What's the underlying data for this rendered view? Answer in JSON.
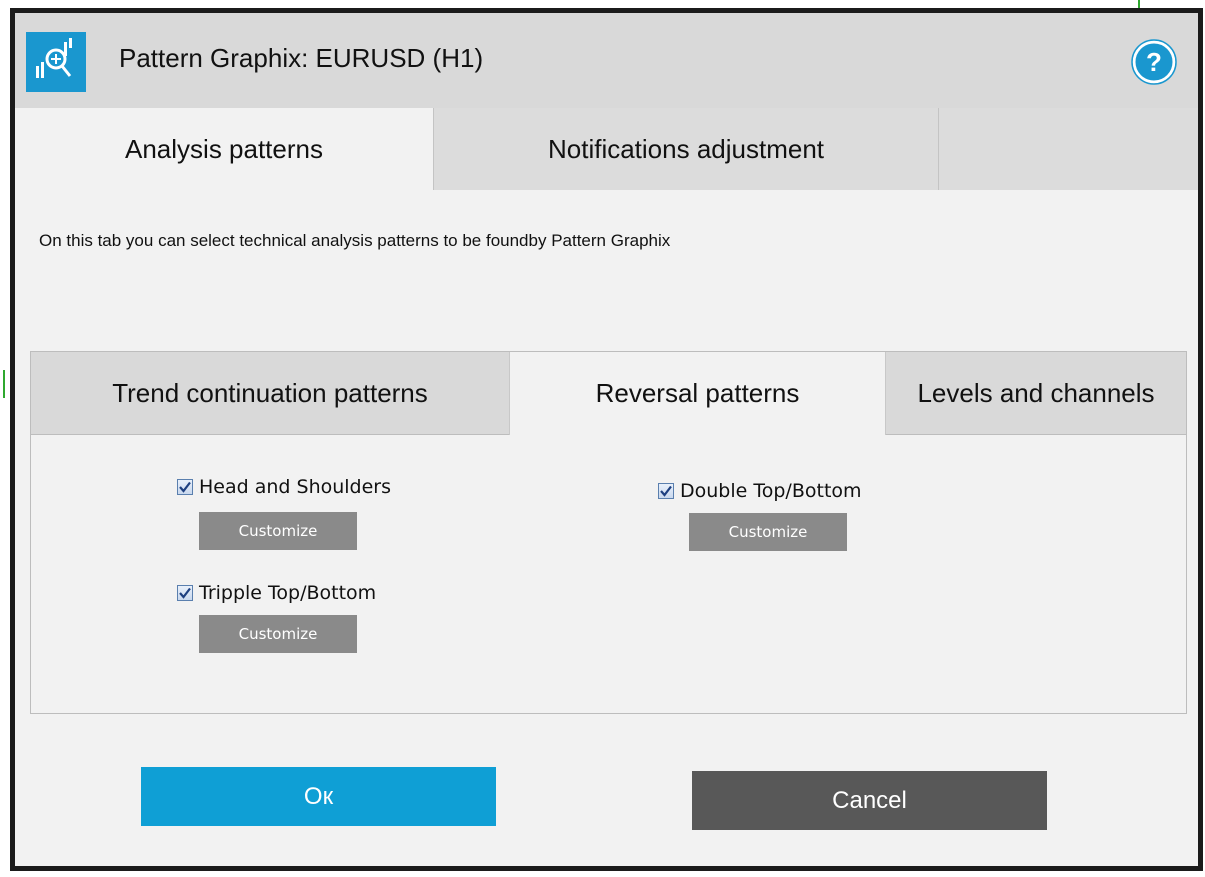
{
  "window": {
    "title": "Pattern Graphix: EURUSD (H1)",
    "app_icon": "pattern-graphix-logo-icon",
    "help_icon": "help-icon"
  },
  "top_tabs": [
    {
      "label": "Analysis patterns",
      "active": true
    },
    {
      "label": "Notifications adjustment",
      "active": false
    }
  ],
  "description": "On this tab you can select technical analysis patterns  to be foundby Pattern Graphix",
  "pattern_tabs": [
    {
      "label": "Trend continuation patterns",
      "active": false
    },
    {
      "label": "Reversal patterns",
      "active": true
    },
    {
      "label": "Levels and channels",
      "active": false
    }
  ],
  "patterns": [
    {
      "label": "Head and Shoulders",
      "checked": true,
      "button": "Customize"
    },
    {
      "label": "Tripple Top/Bottom",
      "checked": true,
      "button": "Customize"
    },
    {
      "label": "Double Top/Bottom",
      "checked": true,
      "button": "Customize"
    }
  ],
  "footer": {
    "ok_label": "Oк",
    "cancel_label": "Cancel"
  },
  "colors": {
    "accent": "#0f9fd5",
    "cancel": "#585858",
    "customize": "#8a8a8a"
  }
}
